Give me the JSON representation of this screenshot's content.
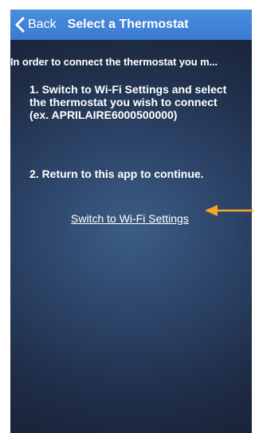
{
  "navbar": {
    "back_label": "Back",
    "title": "Select a Thermostat"
  },
  "content": {
    "intro": "In order to connect the thermostat you m...",
    "step1": "1. Switch to Wi-Fi Settings and select the thermostat you wish to connect (ex. APRILAIRE6000500000)",
    "step2": "2. Return to this app to continue.",
    "link_label": "Switch to Wi-Fi Settings"
  },
  "colors": {
    "navbar": "#3a7bd0",
    "arrow": "#f5a623",
    "text": "#ffffff"
  }
}
